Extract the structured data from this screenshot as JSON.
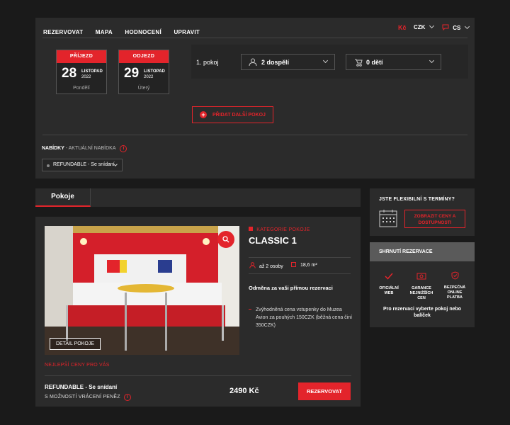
{
  "nav": {
    "items": [
      "REZERVOVAT",
      "MAPA",
      "HODNOCENÍ",
      "UPRAVIT"
    ],
    "currency_symbol": "Kč",
    "currency": "CZK",
    "language": "CS"
  },
  "booking": {
    "arrival": {
      "label": "PŘÍJEZD",
      "day": "28",
      "month": "LISTOPAD",
      "year": "2022",
      "weekday": "Pondělí"
    },
    "departure": {
      "label": "ODJEZD",
      "day": "29",
      "month": "LISTOPAD",
      "year": "2022",
      "weekday": "Úterý"
    },
    "room_label": "1. pokoj",
    "adults": "2 dospělí",
    "children": "0 dětí",
    "add_room": "PŘIDAT DALŠÍ POKOJ"
  },
  "offers": {
    "label": "NABÍDKY",
    "sublabel": "- AKTUÁLNÍ NABÍDKA",
    "selected": "REFUNDABLE - Se snídaní"
  },
  "tabs": {
    "rooms": "Pokoje"
  },
  "room": {
    "category": "KATEGORIE POKOJE",
    "name": "CLASSIC 1",
    "persons": "až 2 osoby",
    "size": "18,6 m²",
    "reward_title": "Odměna za vaši přímou rezervaci",
    "reward_text": "Zvýhodněná cena vstupenky do Muzea Avion za pouhých 150CZK (běžná cena činí 350CZK)",
    "detail_button": "DETAIL POKOJE",
    "best_prices": "NEJLEPŠÍ CENY PRO VÁS",
    "rate_name": "REFUNDABLE - Se snídaní",
    "rate_note": "S MOŽNOSTÍ VRÁCENÍ PENĚZ",
    "price": "2490 Kč",
    "reserve_button": "REZERVOVAT"
  },
  "flexible": {
    "title": "JSTE FLEXIBILNÍ S TERMÍNY?",
    "button": "ZOBRAZIT CENY A DOSTUPNOSTI"
  },
  "summary": {
    "title": "Shrnutí rezervace",
    "features": [
      "OFICIÁLNÍ WEB",
      "GARANCE NEJNIŽŠÍCH CEN",
      "BEZPEČNÁ ONLINE PLATBA"
    ],
    "note": "Pro rezervaci vyberte pokoj nebo balíček"
  },
  "colors": {
    "accent": "#e3242b",
    "panel": "#2b2b2b",
    "background": "#1a1a1a"
  }
}
